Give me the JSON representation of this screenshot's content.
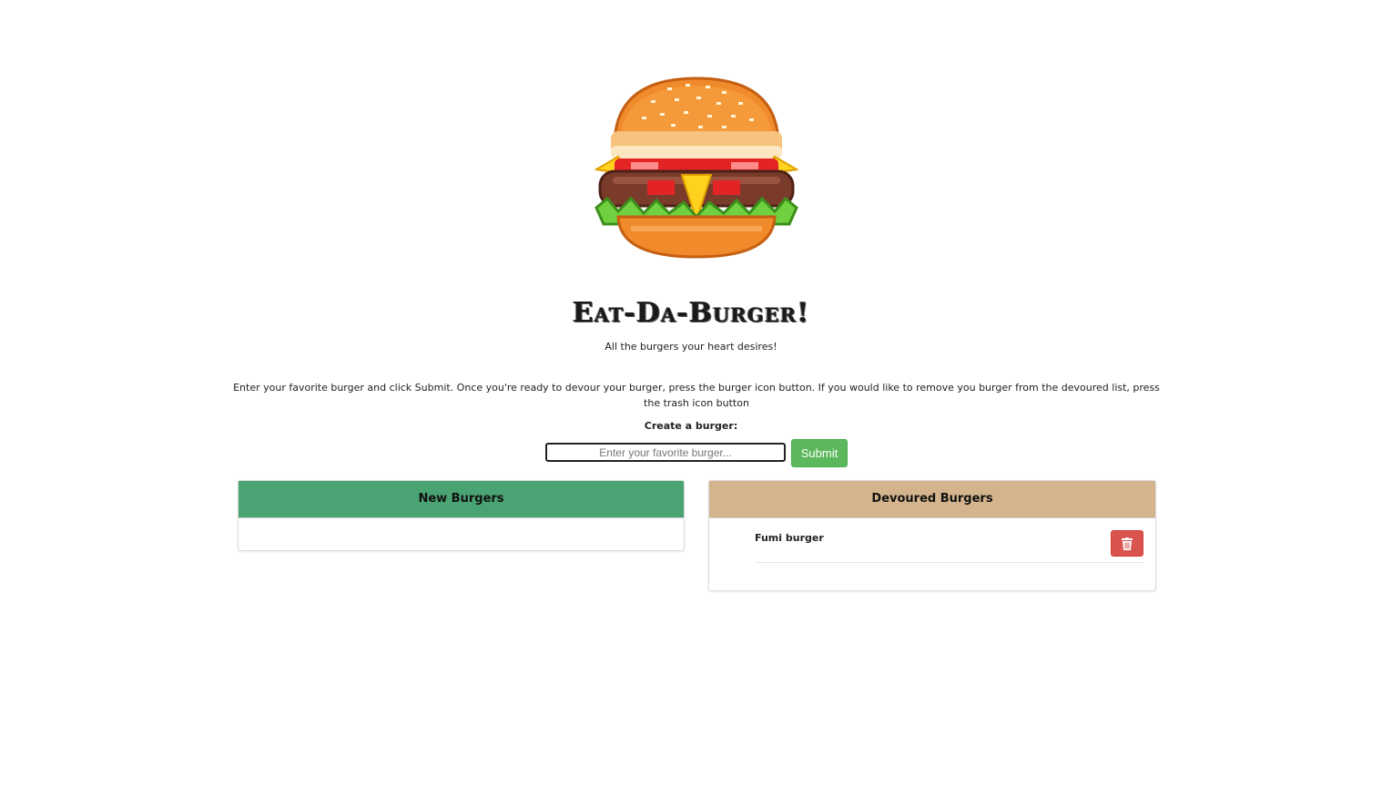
{
  "header": {
    "title": "Eat-Da-Burger!",
    "subtitle": "All the burgers your heart desires!",
    "logo_icon": "burger-icon"
  },
  "instructions": "Enter your favorite burger and click Submit. Once you're ready to devour your burger, press the burger icon button. If you would like to remove you burger from the devoured list, press the trash icon button",
  "form": {
    "label": "Create a burger:",
    "input_value": "",
    "input_placeholder": "Enter your favorite burger...",
    "submit_label": "Submit"
  },
  "new_burgers": {
    "title": "New Burgers",
    "header_color": "#4aa373",
    "items": []
  },
  "devoured_burgers": {
    "title": "Devoured Burgers",
    "header_color": "#d4b48c",
    "items": [
      {
        "name": "Fumi burger",
        "action_icon": "trash-icon"
      }
    ]
  },
  "colors": {
    "submit": "#5cb85c",
    "delete": "#d9534f"
  }
}
